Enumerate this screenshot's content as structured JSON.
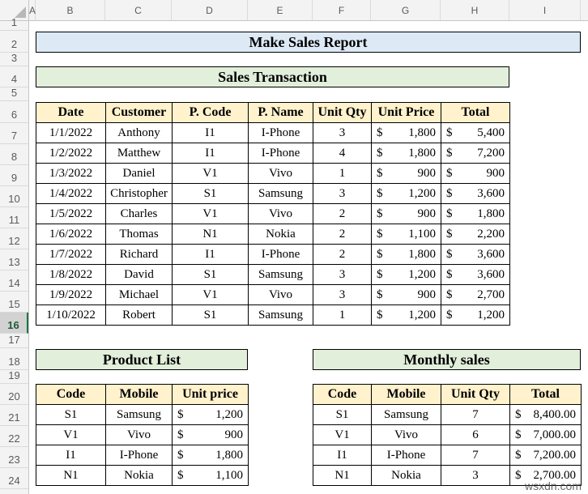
{
  "sheet": {
    "columns": [
      "A",
      "B",
      "C",
      "D",
      "E",
      "F",
      "G",
      "H",
      "I"
    ],
    "rows": [
      "1",
      "2",
      "3",
      "4",
      "5",
      "6",
      "7",
      "8",
      "9",
      "10",
      "11",
      "12",
      "13",
      "14",
      "15",
      "16",
      "17",
      "18",
      "19",
      "20",
      "21",
      "22",
      "23",
      "24"
    ],
    "selected_row": "16"
  },
  "report": {
    "title": "Make Sales Report"
  },
  "transactions": {
    "title": "Sales Transaction",
    "headers": [
      "Date",
      "Customer",
      "P. Code",
      "P. Name",
      "Unit Qty",
      "Unit Price",
      "Total"
    ],
    "rows": [
      {
        "date": "1/1/2022",
        "customer": "Anthony",
        "code": "I1",
        "name": "I-Phone",
        "qty": "3",
        "price": "1,800",
        "total": "5,400"
      },
      {
        "date": "1/2/2022",
        "customer": "Matthew",
        "code": "I1",
        "name": "I-Phone",
        "qty": "4",
        "price": "1,800",
        "total": "7,200"
      },
      {
        "date": "1/3/2022",
        "customer": "Daniel",
        "code": "V1",
        "name": "Vivo",
        "qty": "1",
        "price": "900",
        "total": "900"
      },
      {
        "date": "1/4/2022",
        "customer": "Christopher",
        "code": "S1",
        "name": "Samsung",
        "qty": "3",
        "price": "1,200",
        "total": "3,600"
      },
      {
        "date": "1/5/2022",
        "customer": "Charles",
        "code": "V1",
        "name": "Vivo",
        "qty": "2",
        "price": "900",
        "total": "1,800"
      },
      {
        "date": "1/6/2022",
        "customer": "Thomas",
        "code": "N1",
        "name": "Nokia",
        "qty": "2",
        "price": "1,100",
        "total": "2,200"
      },
      {
        "date": "1/7/2022",
        "customer": "Richard",
        "code": "I1",
        "name": "I-Phone",
        "qty": "2",
        "price": "1,800",
        "total": "3,600"
      },
      {
        "date": "1/8/2022",
        "customer": "David",
        "code": "S1",
        "name": "Samsung",
        "qty": "3",
        "price": "1,200",
        "total": "3,600"
      },
      {
        "date": "1/9/2022",
        "customer": "Michael",
        "code": "V1",
        "name": "Vivo",
        "qty": "3",
        "price": "900",
        "total": "2,700"
      },
      {
        "date": "1/10/2022",
        "customer": "Robert",
        "code": "S1",
        "name": "Samsung",
        "qty": "1",
        "price": "1,200",
        "total": "1,200"
      }
    ],
    "currency": "$"
  },
  "product_list": {
    "title": "Product List",
    "headers": [
      "Code",
      "Mobile",
      "Unit price"
    ],
    "rows": [
      {
        "code": "S1",
        "mobile": "Samsung",
        "price": "1,200"
      },
      {
        "code": "V1",
        "mobile": "Vivo",
        "price": "900"
      },
      {
        "code": "I1",
        "mobile": "I-Phone",
        "price": "1,800"
      },
      {
        "code": "N1",
        "mobile": "Nokia",
        "price": "1,100"
      }
    ],
    "currency": "$"
  },
  "monthly_sales": {
    "title": "Monthly sales",
    "headers": [
      "Code",
      "Mobile",
      "Unit Qty",
      "Total"
    ],
    "rows": [
      {
        "code": "S1",
        "mobile": "Samsung",
        "qty": "7",
        "total": "8,400.00"
      },
      {
        "code": "V1",
        "mobile": "Vivo",
        "qty": "6",
        "total": "7,000.00"
      },
      {
        "code": "I1",
        "mobile": "I-Phone",
        "qty": "7",
        "total": "7,200.00"
      },
      {
        "code": "N1",
        "mobile": "Nokia",
        "qty": "3",
        "total": "2,700.00"
      }
    ],
    "currency": "$"
  },
  "watermark": "wsxdn.com"
}
